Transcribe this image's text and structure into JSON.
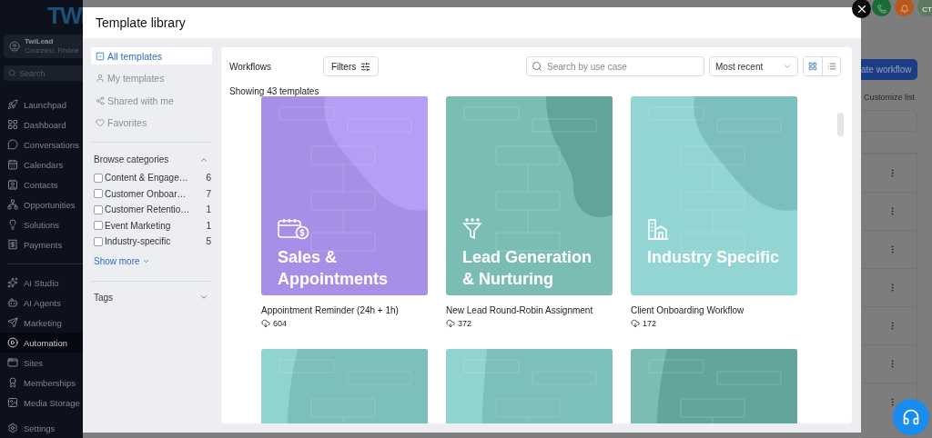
{
  "app": {
    "logo": "TWI",
    "account": {
      "name": "TwiLead",
      "location": "Courzieu, Rhône"
    },
    "search": {
      "placeholder": "Search"
    },
    "nav": [
      {
        "label": "Launchpad",
        "selected": false
      },
      {
        "label": "Dashboard",
        "selected": false
      },
      {
        "label": "Conversations",
        "selected": false
      },
      {
        "label": "Calendars",
        "selected": false
      },
      {
        "label": "Contacts",
        "selected": false
      },
      {
        "label": "Opportunities",
        "selected": false
      },
      {
        "label": "Solutions",
        "selected": false
      },
      {
        "label": "Payments",
        "selected": false
      },
      {
        "label": "AI Studio",
        "selected": false
      },
      {
        "label": "AI Agents",
        "selected": false
      },
      {
        "label": "Marketing",
        "selected": false
      },
      {
        "label": "Automation",
        "selected": true
      },
      {
        "label": "Sites",
        "selected": false
      },
      {
        "label": "Memberships",
        "selected": false
      },
      {
        "label": "Media Storage",
        "selected": false
      },
      {
        "label": "Settings",
        "selected": false
      }
    ],
    "page": {
      "primary_button": "ate workflow",
      "link": "Customize list",
      "avatar": "CT"
    }
  },
  "modal": {
    "title": "Template library",
    "library_nav": [
      {
        "label": "All templates",
        "selected": true
      },
      {
        "label": "My templates",
        "selected": false
      },
      {
        "label": "Shared with me",
        "selected": false
      },
      {
        "label": "Favorites",
        "selected": false
      }
    ],
    "categories": {
      "title": "Browse categories",
      "expanded": true,
      "more": "Show more",
      "items": [
        {
          "label": "Content & Engage…",
          "count": "6",
          "checked": false
        },
        {
          "label": "Customer Onboar…",
          "count": "7",
          "checked": false
        },
        {
          "label": "Customer Retentio…",
          "count": "1",
          "checked": false
        },
        {
          "label": "Event Marketing",
          "count": "1",
          "checked": false
        },
        {
          "label": "Industry-specific",
          "count": "5",
          "checked": false
        }
      ]
    },
    "tags": {
      "title": "Tags",
      "expanded": false
    },
    "toolbar": {
      "title": "Workflows",
      "filters": "Filters",
      "search_placeholder": "Search by use case",
      "sort": "Most recent",
      "views": [
        {
          "selected": true
        },
        {
          "selected": false
        }
      ]
    },
    "count_text": "Showing 43 templates",
    "templates": [
      {
        "color": "#a78ee6",
        "heading": "Sales & Appointments",
        "title": "Appointment Reminder (24h + 1h)",
        "downloads": "604"
      },
      {
        "color": "#7bbdb5",
        "heading": "Lead Generation & Nurturing",
        "title": "New Lead Round-Robin Assignment",
        "downloads": "372"
      },
      {
        "color": "#92d5d2",
        "heading": "Industry Specific",
        "title": "Client Onboarding Workflow",
        "downloads": "172"
      },
      {
        "color": "#90d3cf"
      },
      {
        "color": "#90d3cf"
      },
      {
        "color": "#7bbdb5"
      }
    ]
  }
}
